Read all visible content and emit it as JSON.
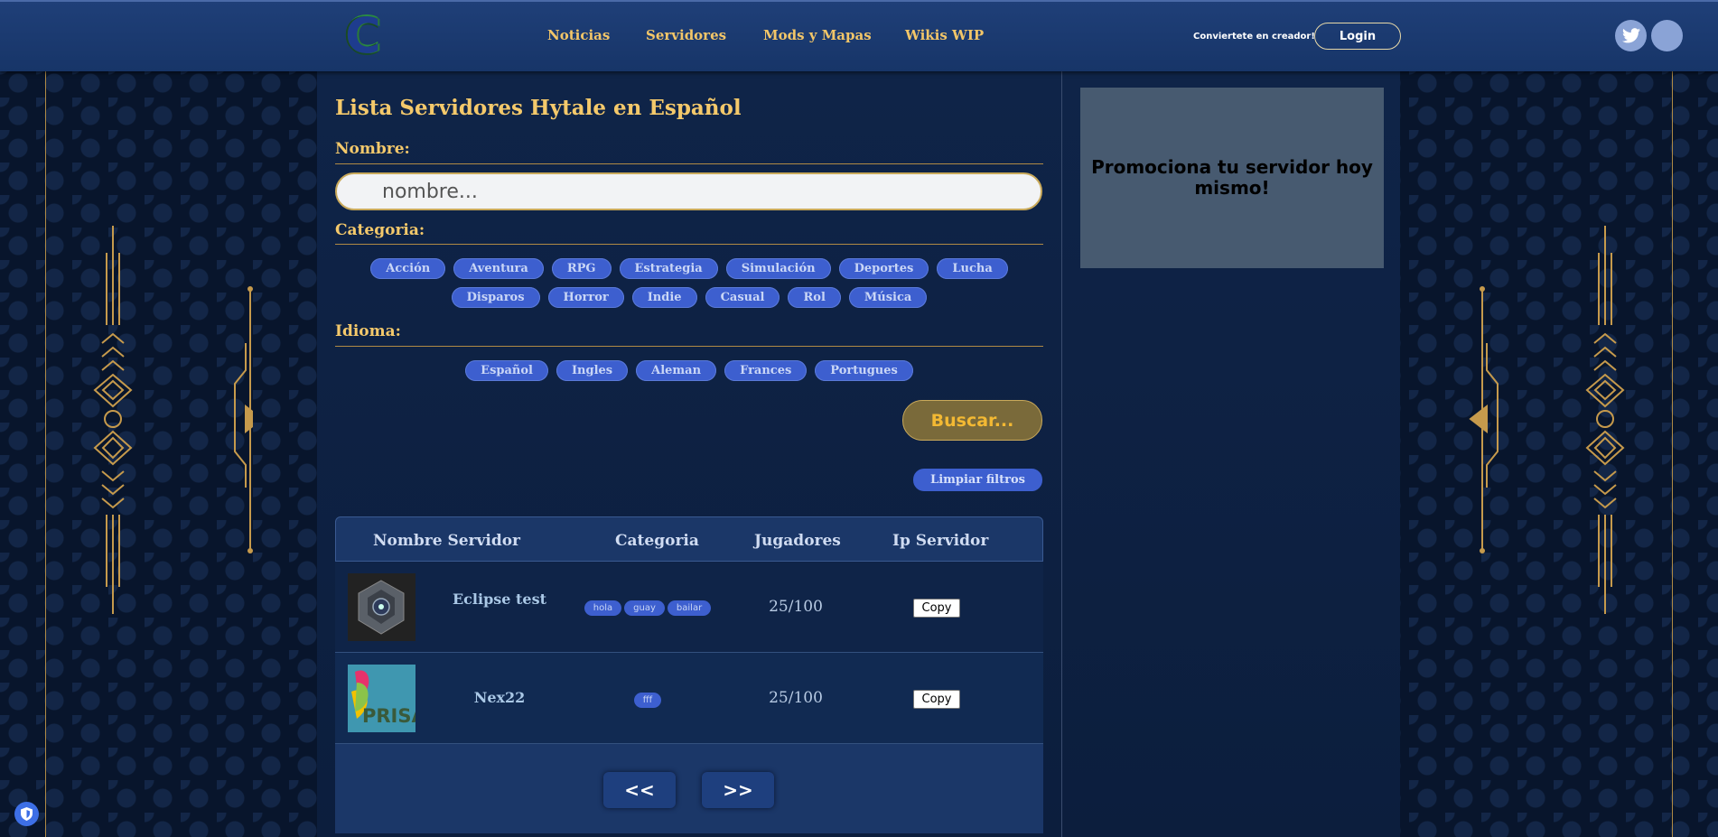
{
  "header": {
    "logo_letter": "C",
    "nav": [
      "Noticias",
      "Servidores",
      "Mods y Mapas",
      "Wikis WIP"
    ],
    "creator_text": "Conviertete en creador!",
    "login_label": "Login"
  },
  "main": {
    "title": "Lista Servidores Hytale en Español",
    "name_label": "Nombre:",
    "name_placeholder": "nombre...",
    "category_label": "Categoria:",
    "categories_row1": [
      "Acción",
      "Aventura",
      "RPG",
      "Estrategia",
      "Simulación",
      "Deportes",
      "Lucha"
    ],
    "categories_row2": [
      "Disparos",
      "Horror",
      "Indie",
      "Casual",
      "Rol",
      "Música"
    ],
    "language_label": "Idioma:",
    "languages": [
      "Español",
      "Ingles",
      "Aleman",
      "Frances",
      "Portugues"
    ],
    "search_button": "Buscar...",
    "clear_button": "Limpiar filtros"
  },
  "table": {
    "headers": [
      "Nombre Servidor",
      "Categoria",
      "Jugadores",
      "Ip Servidor"
    ],
    "rows": [
      {
        "name": "Eclipse test",
        "tags": [
          "hola",
          "guay",
          "bailar"
        ],
        "players": "25/100",
        "copy": "Copy"
      },
      {
        "name": "Nex22",
        "tags": [
          "fff"
        ],
        "players": "25/100",
        "copy": "Copy"
      }
    ],
    "prev": "<<",
    "next": ">>"
  },
  "promo": {
    "text": "Promociona tu servidor hoy mismo!"
  },
  "thumb2_text": "PRISA",
  "colors": {
    "accent_gold": "#f4c96b",
    "pill_blue": "#3d5fcf",
    "nav_bg": "#1f3f78"
  }
}
